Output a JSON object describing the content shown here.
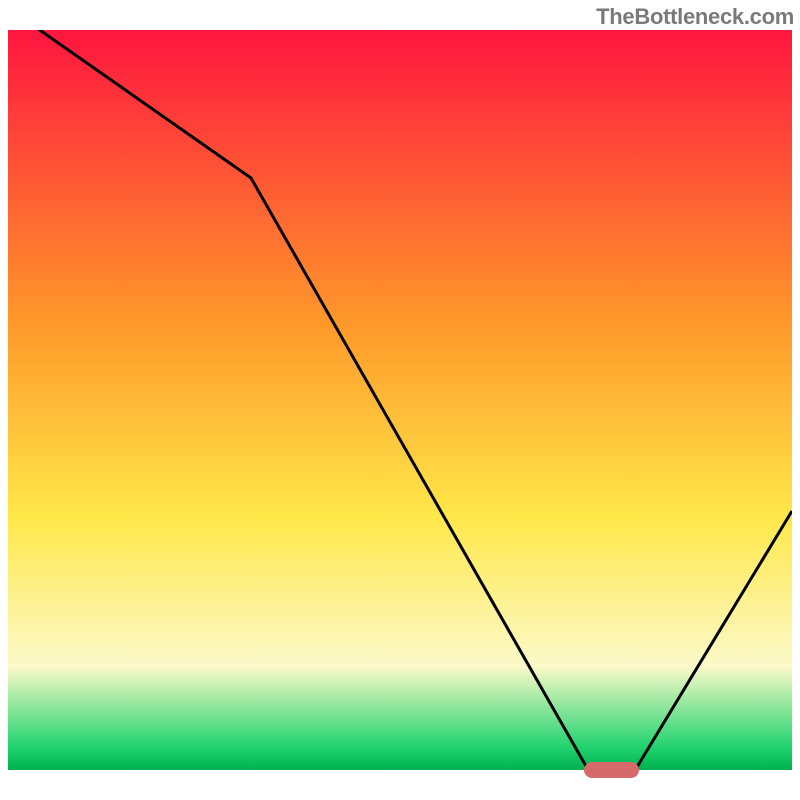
{
  "watermark": "TheBottleneck.com",
  "colors": {
    "gradient_top": "#ff153f",
    "gradient_orange": "#ff9a2a",
    "gradient_yellow": "#ffe84a",
    "gradient_pale": "#fbf9c9",
    "gradient_green": "#1fd36e",
    "gradient_deep_green": "#00b050",
    "curve": "#000000",
    "marker": "#d66a6a",
    "text": "#7a7a7a"
  },
  "chart_data": {
    "type": "line",
    "title": "",
    "xlabel": "",
    "ylabel": "",
    "xlim": [
      0,
      100
    ],
    "ylim": [
      0,
      100
    ],
    "grid": false,
    "series": [
      {
        "name": "curve",
        "x": [
          0,
          31,
          74,
          80,
          100
        ],
        "y": [
          103,
          80,
          0,
          0,
          35
        ]
      }
    ],
    "marker": {
      "x_start": 74,
      "x_end": 80,
      "y": 0
    },
    "gradient_stops": [
      {
        "pct": 0,
        "color": "#ff153f"
      },
      {
        "pct": 40,
        "color": "#ff9a2a"
      },
      {
        "pct": 66,
        "color": "#ffe84a"
      },
      {
        "pct": 86,
        "color": "#fbf9c9"
      },
      {
        "pct": 97,
        "color": "#1fd36e"
      },
      {
        "pct": 100,
        "color": "#00b050"
      }
    ]
  }
}
